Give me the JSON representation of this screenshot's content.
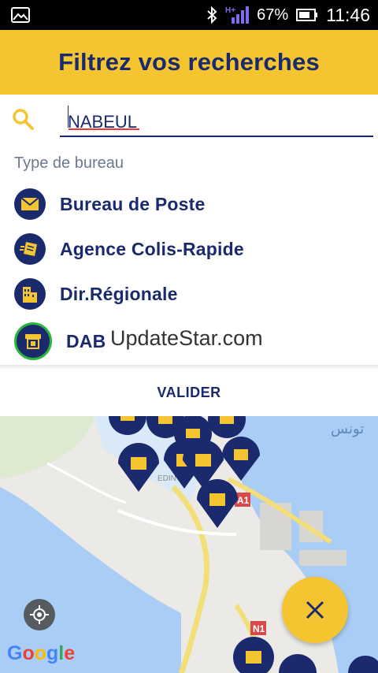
{
  "status_bar": {
    "battery_percent": "67%",
    "time": "11:46",
    "network": "H+"
  },
  "header": {
    "title": "Filtrez vos recherches"
  },
  "search": {
    "value": "NABEUL",
    "icon": "search-icon"
  },
  "filters": {
    "section_label": "Type de bureau",
    "items": [
      {
        "label": "Bureau de Poste",
        "icon": "envelope-icon"
      },
      {
        "label": "Agence Colis-Rapide",
        "icon": "parcel-icon"
      },
      {
        "label": "Dir.Régionale",
        "icon": "building-icon"
      },
      {
        "label": "DAB",
        "icon": "atm-icon",
        "selected": true
      }
    ]
  },
  "watermark": "UpdateStar.com",
  "actions": {
    "validate_label": "VALIDER"
  },
  "map": {
    "road_labels": [
      "A1",
      "N1"
    ],
    "arabic_label": "تونس",
    "area_label": "EDIN",
    "attribution": "Google"
  },
  "colors": {
    "brand_yellow": "#f5c531",
    "brand_navy": "#1a2a6c",
    "selected_ring": "#2bb63e"
  }
}
